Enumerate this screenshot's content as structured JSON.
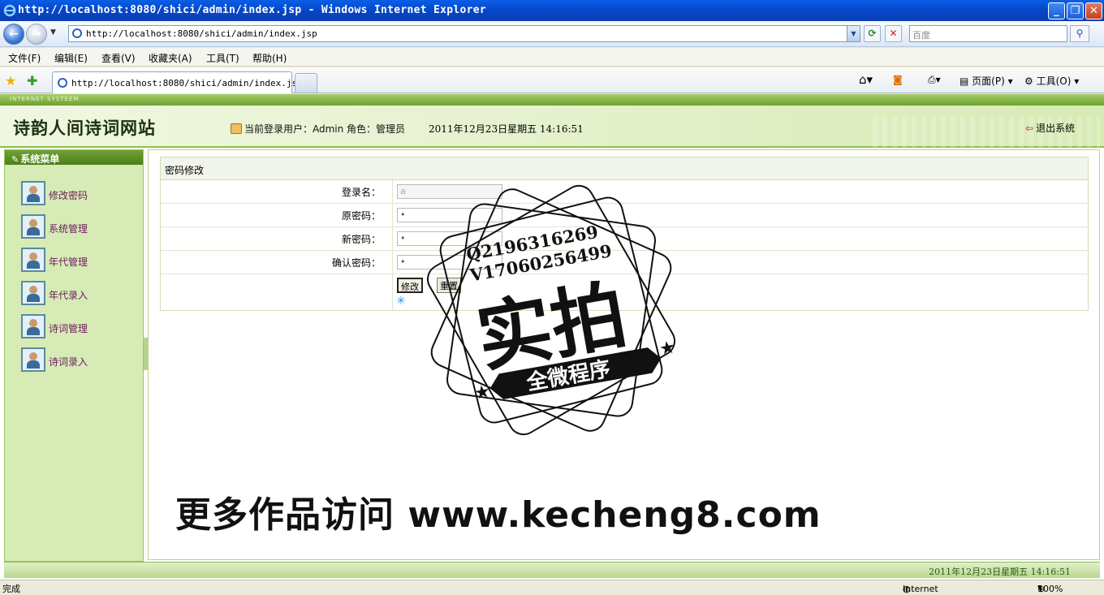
{
  "window": {
    "title": "http://localhost:8080/shici/admin/index.jsp - Windows Internet Explorer"
  },
  "browser": {
    "address": "http://localhost:8080/shici/admin/index.jsp",
    "search_placeholder": "百度",
    "menu": [
      "文件(F)",
      "编辑(E)",
      "查看(V)",
      "收藏夹(A)",
      "工具(T)",
      "帮助(H)"
    ],
    "tab_title": "http://localhost:8080/shici/admin/index.jsp",
    "toolbar": {
      "page": "页面(P)",
      "tools": "工具(O)"
    },
    "status_left": "完成",
    "status_zone": "Internet",
    "zoom": "100%"
  },
  "site": {
    "title": "诗韵人间诗词网站",
    "strip_text": "INTERNET SYSTEEM",
    "user_info": "当前登录用户：Admin 角色：管理员",
    "datetime": "2011年12月23日星期五  14:16:51",
    "logout": "退出系统"
  },
  "sidebar": {
    "title": "系统菜单",
    "items": [
      {
        "label": "修改密码"
      },
      {
        "label": "系统管理"
      },
      {
        "label": "年代管理"
      },
      {
        "label": "年代录入"
      },
      {
        "label": "诗词管理"
      },
      {
        "label": "诗词录入"
      }
    ]
  },
  "form": {
    "caption": "密码修改",
    "login_label": "登录名：",
    "login_value": "a",
    "old_label": "原密码：",
    "old_value": "•",
    "new_label": "新密码：",
    "new_value": "•",
    "confirm_label": "确认密码：",
    "confirm_value": "•",
    "submit": "修改",
    "reset": "重置"
  },
  "footer": {
    "datetime": "2011年12月23日星期五  14:16:51"
  },
  "watermark": {
    "line1": "Q2196316269",
    "line2": "V17060256499",
    "main": "实拍",
    "sub": "全微程序",
    "bottom": "更多作品访问 www.kecheng8.com"
  }
}
